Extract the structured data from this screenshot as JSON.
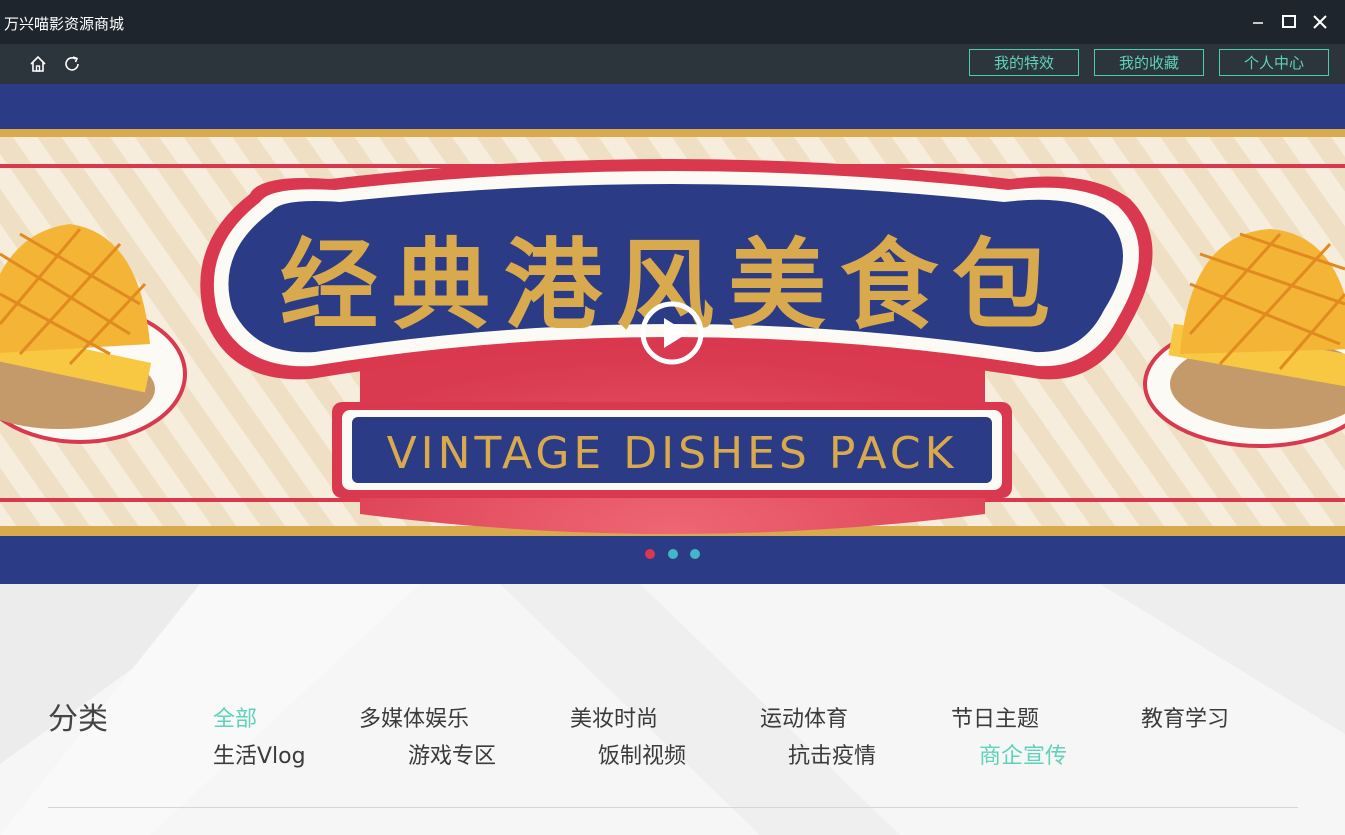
{
  "window": {
    "title": "万兴喵影资源商城"
  },
  "toolbar": {
    "home_icon": "home-icon",
    "refresh_icon": "refresh-icon",
    "buttons": [
      "我的特效",
      "我的收藏",
      "个人中心"
    ]
  },
  "banner": {
    "headline": "经典港风美食包",
    "subtitle": "VINTAGE DISHES PACK",
    "dots": 3,
    "active_dot": 1
  },
  "category": {
    "title": "分类",
    "items": [
      "全部",
      "多媒体娱乐",
      "美妆时尚",
      "运动体育",
      "节日主题",
      "教育学习",
      "生活Vlog",
      "游戏专区",
      "饭制视频",
      "抗击疫情",
      "商企宣传"
    ],
    "highlighted": [
      "全部",
      "商企宣传"
    ]
  },
  "colors": {
    "accent": "#5fd2bb",
    "titlebar": "#1e252c",
    "toolbar": "#2c343c",
    "banner_navy": "#2b3b85",
    "banner_red": "#d9384f",
    "banner_gold": "#d8a94d"
  }
}
